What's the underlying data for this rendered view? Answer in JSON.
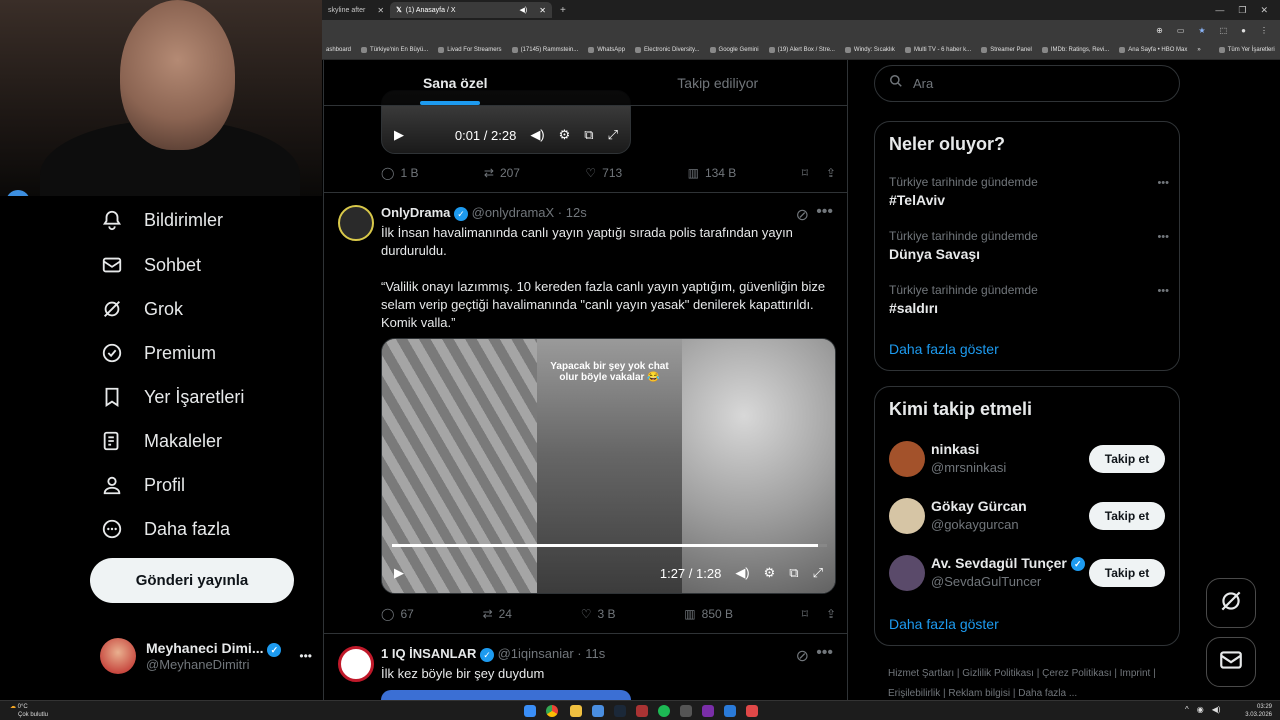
{
  "browser": {
    "tabs": [
      {
        "title": "skyline after",
        "active": false
      },
      {
        "title": "(1) Anasayfa / X",
        "active": true
      }
    ],
    "new_tab": "+",
    "bookmarks": [
      "ashboard",
      "Türkiye'nin En Büyü...",
      "Livad For Streamers",
      "(17145) Rammstein...",
      "WhatsApp",
      "Electronic Diversity...",
      "Google Gemini",
      "(19) Alert Box / Stre...",
      "Windy: Sıcaklık",
      "Multi TV - 6 haber k...",
      "Streamer Panel",
      "IMDb: Ratings, Revi...",
      "Ana Sayfa • HBO Max",
      "»",
      "Tüm Yer İşaretleri"
    ]
  },
  "nav": {
    "items": [
      {
        "label": "Bildirimler",
        "icon": "bell-icon"
      },
      {
        "label": "Sohbet",
        "icon": "mail-icon"
      },
      {
        "label": "Grok",
        "icon": "grok-icon"
      },
      {
        "label": "Premium",
        "icon": "premium-icon"
      },
      {
        "label": "Yer İşaretleri",
        "icon": "bookmark-icon"
      },
      {
        "label": "Makaleler",
        "icon": "article-icon"
      },
      {
        "label": "Profil",
        "icon": "person-icon"
      },
      {
        "label": "Daha fazla",
        "icon": "more-circle-icon"
      }
    ],
    "post_button": "Gönderi yayınla",
    "account": {
      "name": "Meyhaneci Dimi...",
      "handle": "@MeyhaneDimitri",
      "more": "•••"
    }
  },
  "timeline": {
    "tabs": [
      "Sana özel",
      "Takip ediliyor"
    ],
    "top_video": {
      "time": "0:01 / 2:28"
    },
    "top_actions": {
      "replies": "1 B",
      "reposts": "207",
      "likes": "713",
      "views": "134 B"
    },
    "tweet1": {
      "name": "OnlyDrama",
      "handle": "@onlydramaX · 12s",
      "text1": "İlk İnsan havalimanında canlı yayın yaptığı sırada polis tarafından yayın durduruldu.",
      "text2": "“Valilik onayı lazımmış. 10 kereden fazla canlı yayın yaptığım, güvenliğin bize selam verip geçtiği havalimanında \"canlı yayın yasak\" denilerek kapattırıldı. Komik valla.”",
      "video_caption": "Yapacak bir şey yok chat olur böyle vakalar 😂",
      "video_time": "1:27 / 1:28",
      "replies": "67",
      "reposts": "24",
      "likes": "3 B",
      "views": "850 B"
    },
    "tweet2": {
      "name": "1 IQ İNSANLAR",
      "handle": "@1iqinsaniar · 11s",
      "text": "İlk kez böyle bir şey duydum"
    }
  },
  "right": {
    "search_placeholder": "Ara",
    "trends_title": "Neler oluyor?",
    "trends": [
      {
        "category": "Türkiye tarihinde gündemde",
        "name": "#TelAviv"
      },
      {
        "category": "Türkiye tarihinde gündemde",
        "name": "Dünya Savaşı"
      },
      {
        "category": "Türkiye tarihinde gündemde",
        "name": "#saldırı"
      }
    ],
    "trends_more": "Daha fazla göster",
    "follow_title": "Kimi takip etmeli",
    "follows": [
      {
        "name": "ninkasi",
        "handle": "@mrsninkasi",
        "button": "Takip et"
      },
      {
        "name": "Gökay Gürcan",
        "handle": "@gokaygurcan",
        "button": "Takip et"
      },
      {
        "name": "Av. Sevdagül Tunçer",
        "handle": "@SevdaGulTuncer",
        "button": "Takip et"
      }
    ],
    "follow_more": "Daha fazla göster",
    "footer": [
      "Hizmet Şartları",
      "Gizlilik Politikası",
      "Çerez Politikası",
      "Imprint",
      "Erişilebilirlik",
      "Reklam bilgisi",
      "Daha fazla ..."
    ]
  },
  "taskbar": {
    "weather_temp": "0°C",
    "weather_desc": "Çok bulutlu",
    "time": "03:29",
    "date": "3.03.2026"
  }
}
